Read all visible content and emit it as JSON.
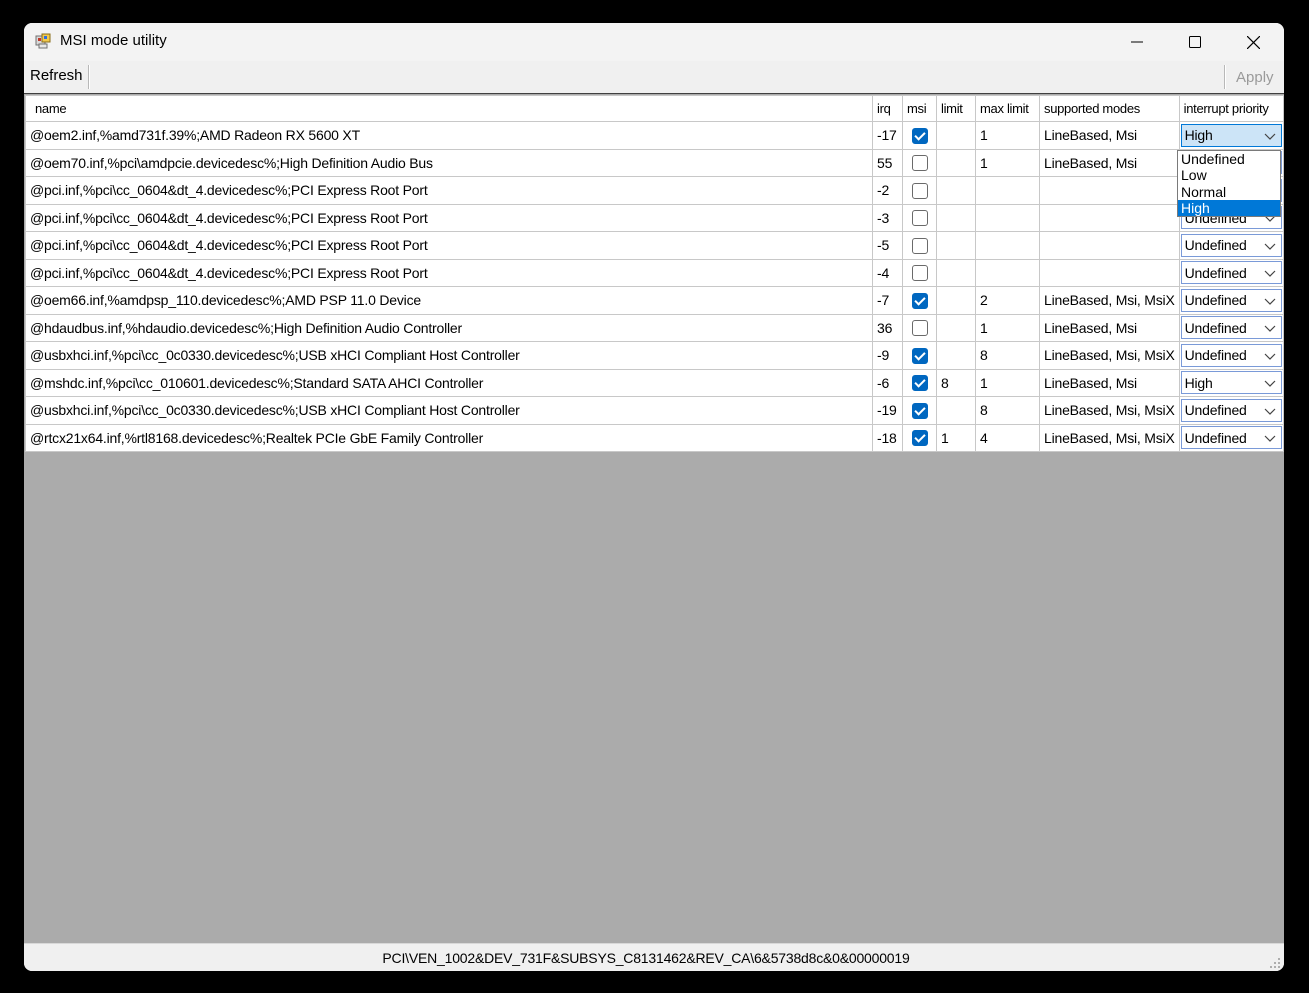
{
  "window": {
    "title": "MSI mode utility",
    "icon": "msi-app-icon",
    "controls": [
      "minimize-icon",
      "maximize-icon",
      "close-icon"
    ]
  },
  "toolbar": {
    "refresh_label": "Refresh",
    "apply_label": "Apply"
  },
  "grid": {
    "columns": [
      "name",
      "irq",
      "msi",
      "limit",
      "max limit",
      "supported modes",
      "interrupt priority"
    ],
    "rows": [
      {
        "name": "@oem2.inf,%amd731f.39%;AMD Radeon RX 5600 XT",
        "irq": "-17",
        "msi": true,
        "limit": "",
        "max_limit": "1",
        "modes": "LineBased, Msi",
        "priority": "High"
      },
      {
        "name": "@oem70.inf,%pci\\amdpcie.devicedesc%;High Definition Audio Bus",
        "irq": "55",
        "msi": false,
        "limit": "",
        "max_limit": "1",
        "modes": "LineBased, Msi",
        "priority": "Undefined"
      },
      {
        "name": "@pci.inf,%pci\\cc_0604&dt_4.devicedesc%;PCI Express Root Port",
        "irq": "-2",
        "msi": false,
        "limit": "",
        "max_limit": "",
        "modes": "",
        "priority": "Undefined"
      },
      {
        "name": "@pci.inf,%pci\\cc_0604&dt_4.devicedesc%;PCI Express Root Port",
        "irq": "-3",
        "msi": false,
        "limit": "",
        "max_limit": "",
        "modes": "",
        "priority": "Undefined"
      },
      {
        "name": "@pci.inf,%pci\\cc_0604&dt_4.devicedesc%;PCI Express Root Port",
        "irq": "-5",
        "msi": false,
        "limit": "",
        "max_limit": "",
        "modes": "",
        "priority": "Undefined"
      },
      {
        "name": "@pci.inf,%pci\\cc_0604&dt_4.devicedesc%;PCI Express Root Port",
        "irq": "-4",
        "msi": false,
        "limit": "",
        "max_limit": "",
        "modes": "",
        "priority": "Undefined"
      },
      {
        "name": "@oem66.inf,%amdpsp_110.devicedesc%;AMD PSP 11.0 Device",
        "irq": "-7",
        "msi": true,
        "limit": "",
        "max_limit": "2",
        "modes": "LineBased, Msi, MsiX",
        "priority": "Undefined"
      },
      {
        "name": "@hdaudbus.inf,%hdaudio.devicedesc%;High Definition Audio Controller",
        "irq": "36",
        "msi": false,
        "limit": "",
        "max_limit": "1",
        "modes": "LineBased, Msi",
        "priority": "Undefined"
      },
      {
        "name": "@usbxhci.inf,%pci\\cc_0c0330.devicedesc%;USB xHCI Compliant Host Controller",
        "irq": "-9",
        "msi": true,
        "limit": "",
        "max_limit": "8",
        "modes": "LineBased, Msi, MsiX",
        "priority": "Undefined"
      },
      {
        "name": "@mshdc.inf,%pci\\cc_010601.devicedesc%;Standard SATA AHCI Controller",
        "irq": "-6",
        "msi": true,
        "limit": "8",
        "max_limit": "1",
        "modes": "LineBased, Msi",
        "priority": "High"
      },
      {
        "name": "@usbxhci.inf,%pci\\cc_0c0330.devicedesc%;USB xHCI Compliant Host Controller",
        "irq": "-19",
        "msi": true,
        "limit": "",
        "max_limit": "8",
        "modes": "LineBased, Msi, MsiX",
        "priority": "Undefined"
      },
      {
        "name": "@rtcx21x64.inf,%rtl8168.devicedesc%;Realtek PCIe GbE Family Controller",
        "irq": "-18",
        "msi": true,
        "limit": "1",
        "max_limit": "4",
        "modes": "LineBased, Msi, MsiX",
        "priority": "Undefined"
      }
    ]
  },
  "dropdown": {
    "options": [
      "Undefined",
      "Low",
      "Normal",
      "High"
    ],
    "selected": "High"
  },
  "statusbar": {
    "text": "PCI\\VEN_1002&DEV_731F&SUBSYS_C8131462&REV_CA\\6&5738d8c&0&00000019"
  },
  "colors": {
    "accent": "#0078d7",
    "checkbox_checked": "#0067c0",
    "empty_area": "#ababab"
  }
}
